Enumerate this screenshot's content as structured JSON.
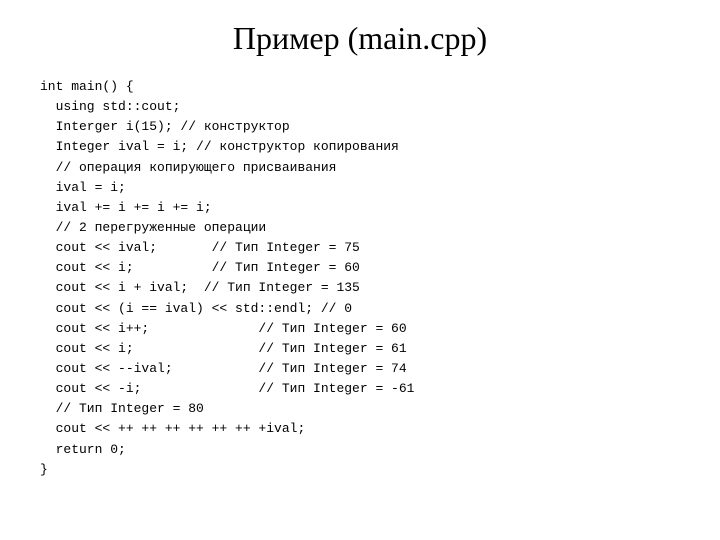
{
  "header": {
    "title": "Пример (main.cpp)"
  },
  "code": {
    "lines": [
      "int main() {",
      "  using std::cout;",
      "  Interger i(15); // конструктор",
      "  Integer ival = i; // конструктор копирования",
      "  // операция копирующего присваивания",
      "  ival = i;",
      "  ival += i += i += i;",
      "  // 2 перегруженные операции",
      "  cout << ival;       // Тип Integer = 75",
      "  cout << i;          // Тип Integer = 60",
      "  cout << i + ival;  // Тип Integer = 135",
      "  cout << (i == ival) << std::endl; // 0",
      "  cout << i++;              // Тип Integer = 60",
      "  cout << i;                // Тип Integer = 61",
      "  cout << --ival;           // Тип Integer = 74",
      "  cout << -i;               // Тип Integer = -61",
      "  // Тип Integer = 80",
      "  cout << ++ ++ ++ ++ ++ ++ +ival;",
      "  return 0;",
      "}"
    ]
  }
}
